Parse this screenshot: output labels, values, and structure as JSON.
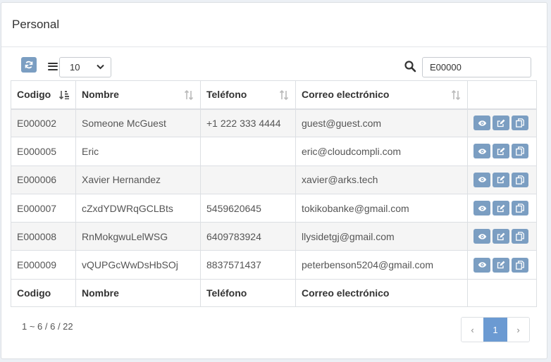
{
  "panel": {
    "title": "Personal"
  },
  "toolbar": {
    "page_size": "10",
    "search_value": "E00000"
  },
  "table": {
    "columns": [
      "Codigo",
      "Nombre",
      "Teléfono",
      "Correo electrónico"
    ],
    "rows": [
      {
        "codigo": "E000002",
        "nombre": "Someone McGuest",
        "telefono": "+1 222 333 4444",
        "correo": "guest@guest.com"
      },
      {
        "codigo": "E000005",
        "nombre": "Eric",
        "telefono": "",
        "correo": "eric@cloudcompli.com"
      },
      {
        "codigo": "E000006",
        "nombre": "Xavier Hernandez",
        "telefono": "",
        "correo": "xavier@arks.tech"
      },
      {
        "codigo": "E000007",
        "nombre": "cZxdYDWRqGCLBts",
        "telefono": "5459620645",
        "correo": "tokikobanke@gmail.com"
      },
      {
        "codigo": "E000008",
        "nombre": "RnMokgwuLelWSG",
        "telefono": "6409783924",
        "correo": "llysidetgj@gmail.com"
      },
      {
        "codigo": "E000009",
        "nombre": "vQUPGcWwDsHbSOj",
        "telefono": "8837571437",
        "correo": "peterbenson5204@gmail.com"
      }
    ]
  },
  "footer": {
    "info": "1 ~ 6 / 6 / 22",
    "prev": "‹",
    "current_page": "1",
    "next": "›"
  },
  "icons": {
    "refresh": "refresh-icon",
    "menu": "list-icon",
    "search": "search-icon",
    "view": "eye-icon",
    "edit": "edit-icon",
    "copy": "copy-icon"
  },
  "colors": {
    "button": "#7b9ec2",
    "active_page": "#6b9ad2"
  }
}
